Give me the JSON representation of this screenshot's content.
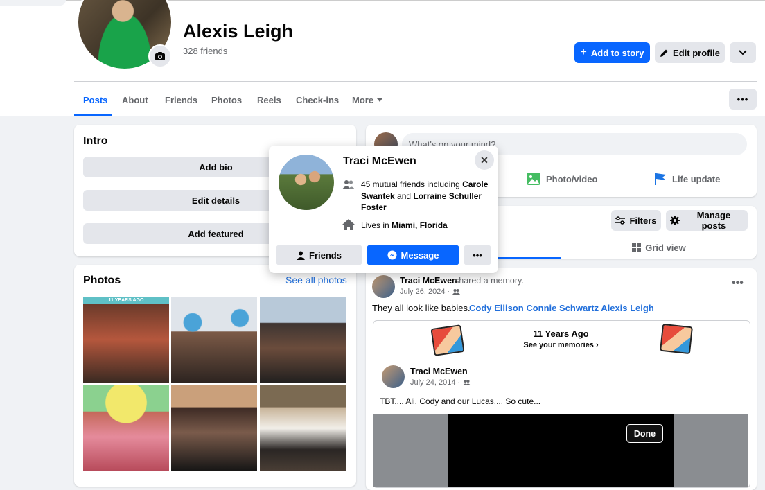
{
  "profile": {
    "name": "Alexis Leigh",
    "friends_count": "328 friends",
    "add_to_story": "Add to story",
    "edit_profile": "Edit profile"
  },
  "tabs": [
    "Posts",
    "About",
    "Friends",
    "Photos",
    "Reels",
    "Check-ins",
    "More"
  ],
  "intro": {
    "title": "Intro",
    "buttons": [
      "Add bio",
      "Edit details",
      "Add featured"
    ]
  },
  "photos": {
    "title": "Photos",
    "see_all": "See all photos",
    "first_photo_label": "11 YEARS AGO"
  },
  "composer": {
    "placeholder": "What's on your mind?",
    "photo_video": "Photo/video",
    "life_update": "Life update"
  },
  "filters": {
    "filters_label": "Filters",
    "manage_posts": "Manage posts",
    "grid_view": "Grid view"
  },
  "post": {
    "author": "Traci McEwen",
    "action": "shared a memory.",
    "date": "July 26, 2024 ·",
    "text": "They all look like babies.",
    "tags": "Cody Ellison Connie Schwartz Alexis Leigh",
    "memory_title": "11 Years Ago",
    "memory_sub": "See your memories",
    "original_author": "Traci McEwen",
    "original_date": "July 24, 2014 ·",
    "original_text": "TBT.... Ali, Cody and our Lucas.... So cute...",
    "done": "Done"
  },
  "hovercard": {
    "name": "Traci McEwen",
    "mutual_prefix": "45 mutual friends including ",
    "mutual_name1": "Carole Swantek",
    "mutual_and": " and ",
    "mutual_name2": "Lorraine Schuller Foster",
    "lives_prefix": "Lives in ",
    "lives_place": "Miami, Florida",
    "friends_btn": "Friends",
    "message_btn": "Message"
  },
  "colors": {
    "accent": "#0866ff",
    "link": "#216fdb",
    "background": "#f0f2f5"
  }
}
